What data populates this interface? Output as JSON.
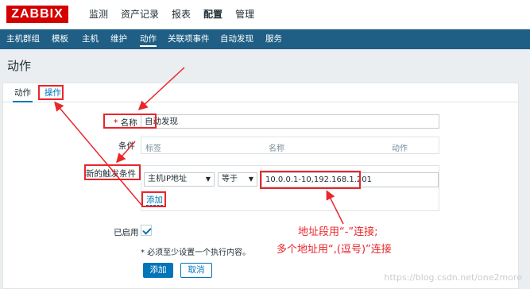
{
  "logo": "ZABBIX",
  "top_menu": [
    "监测",
    "资产记录",
    "报表",
    "配置",
    "管理"
  ],
  "sub_nav": [
    "主机群组",
    "模板",
    "主机",
    "维护",
    "动作",
    "关联项事件",
    "自动发现",
    "服务"
  ],
  "page_title": "动作",
  "tabs": [
    "动作",
    "操作"
  ],
  "form": {
    "name_required_mark": "*",
    "name_label": "名称",
    "name_value": "自动发现",
    "conditions_label": "条件",
    "conditions_columns": [
      "标签",
      "名称",
      "动作"
    ],
    "new_condition_label": "新的触发条件",
    "condition_type_value": "主机IP地址",
    "operator_value": "等于",
    "condition_value": "10.0.0.1-10,192.168.1.201",
    "add_link": "添加",
    "enabled_label": "已启用",
    "enabled_checked": true,
    "required_note": "* 必须至少设置一个执行内容。",
    "add_button": "添加",
    "cancel_button": "取消"
  },
  "annotation": {
    "line1": "地址段用“-”连接;",
    "line2": "多个地址用“,(逗号)”连接"
  },
  "watermark": "https://blog.csdn.net/one2more",
  "colors": {
    "brand_red": "#d40000",
    "nav_blue": "#1f5f85",
    "link_blue": "#0275b8",
    "annotation_red": "#e8262b"
  }
}
